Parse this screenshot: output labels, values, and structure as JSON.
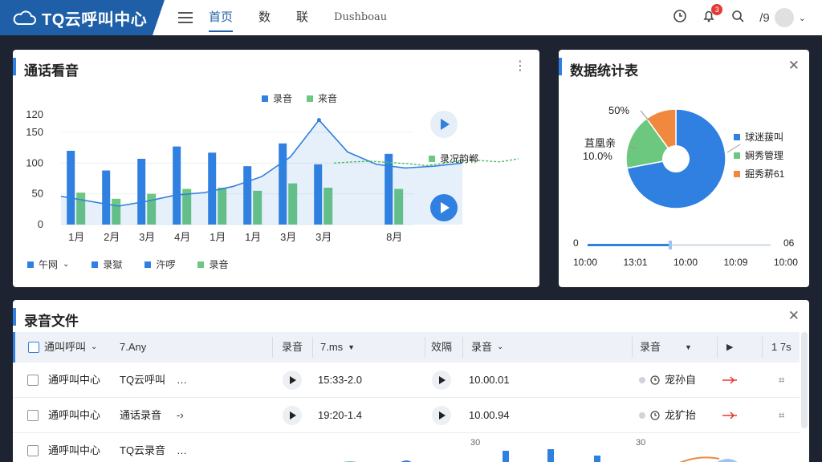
{
  "app": {
    "title": "TQ云呼叫中心"
  },
  "nav": {
    "tabs": [
      "首页",
      "数",
      "联",
      "Dushboau"
    ],
    "active_index": 0
  },
  "header": {
    "notification_count": "3",
    "user_label": "/9"
  },
  "chart_card": {
    "title": "通话看音",
    "legend_top": [
      "录音",
      "来音"
    ],
    "series_tag": "录况韵郸",
    "legend_bottom": [
      "午网",
      "录獄",
      "汻啰",
      "录音"
    ],
    "colors": {
      "bar_blue": "#2f80e0",
      "bar_green": "#6cc77f",
      "line": "#2f80e0",
      "line_green": "#4fbf5a"
    }
  },
  "chart_data": {
    "type": "bar",
    "categories": [
      "1月",
      "2月",
      "3月",
      "4月",
      "1月",
      "1月",
      "3月",
      "3月",
      "",
      "8月"
    ],
    "series": [
      {
        "name": "录音",
        "values": [
          120,
          88,
          107,
          127,
          117,
          95,
          132,
          98,
          null,
          115
        ]
      },
      {
        "name": "来音",
        "values": [
          52,
          42,
          50,
          58,
          60,
          55,
          67,
          60,
          null,
          58
        ]
      }
    ],
    "line_values": [
      46,
      38,
      30,
      38,
      48,
      52,
      62,
      78,
      110,
      170,
      118,
      98,
      92,
      95,
      100
    ],
    "green_line_values": [
      100,
      102,
      103,
      101,
      99,
      96,
      100,
      105,
      104,
      102,
      107
    ],
    "yticks": [
      0,
      50,
      100,
      150,
      120
    ],
    "ylim": [
      0,
      180
    ],
    "grid": true
  },
  "stats_card": {
    "title": "数据统计表",
    "pie": {
      "slices": [
        {
          "label": "球迷菝叫",
          "value": 72,
          "color": "#2f80e0"
        },
        {
          "label": "娴秀管理",
          "value": 18,
          "color": "#6cc77f"
        },
        {
          "label": "掘秀菥61",
          "value": 10,
          "color": "#f0883e"
        }
      ],
      "label_top": "50%",
      "label_left_1": "苴凰亲",
      "label_left_2": "10.0%"
    },
    "slider": {
      "start": "0",
      "end": "06",
      "value": 0.45
    },
    "times": [
      "10:00",
      "13:01",
      "10:00",
      "10:09",
      "10:00"
    ]
  },
  "files_card": {
    "title": "录音文件",
    "headers": [
      "通叫呼叫",
      "7.Any",
      "录音",
      "7.ms",
      "效隔",
      "录音",
      "录音",
      "1 7s"
    ],
    "rows": [
      {
        "name": "通呼叫中心",
        "source": "TQ云呼叫",
        "extra": "…",
        "time": "15:33-2.0",
        "dur": "10.00.01",
        "owner": "宠孙自"
      },
      {
        "name": "通呼叫中心",
        "source": "通话录音",
        "extra": "-›",
        "time": "19:20-1.4",
        "dur": "10.00.94",
        "owner": "龙犷抬"
      },
      {
        "name": "通呼叫中心",
        "source": "TQ云录音",
        "extra": "…",
        "time": "",
        "dur": "",
        "owner": ""
      }
    ],
    "mini_axis": [
      "30",
      "30"
    ]
  }
}
